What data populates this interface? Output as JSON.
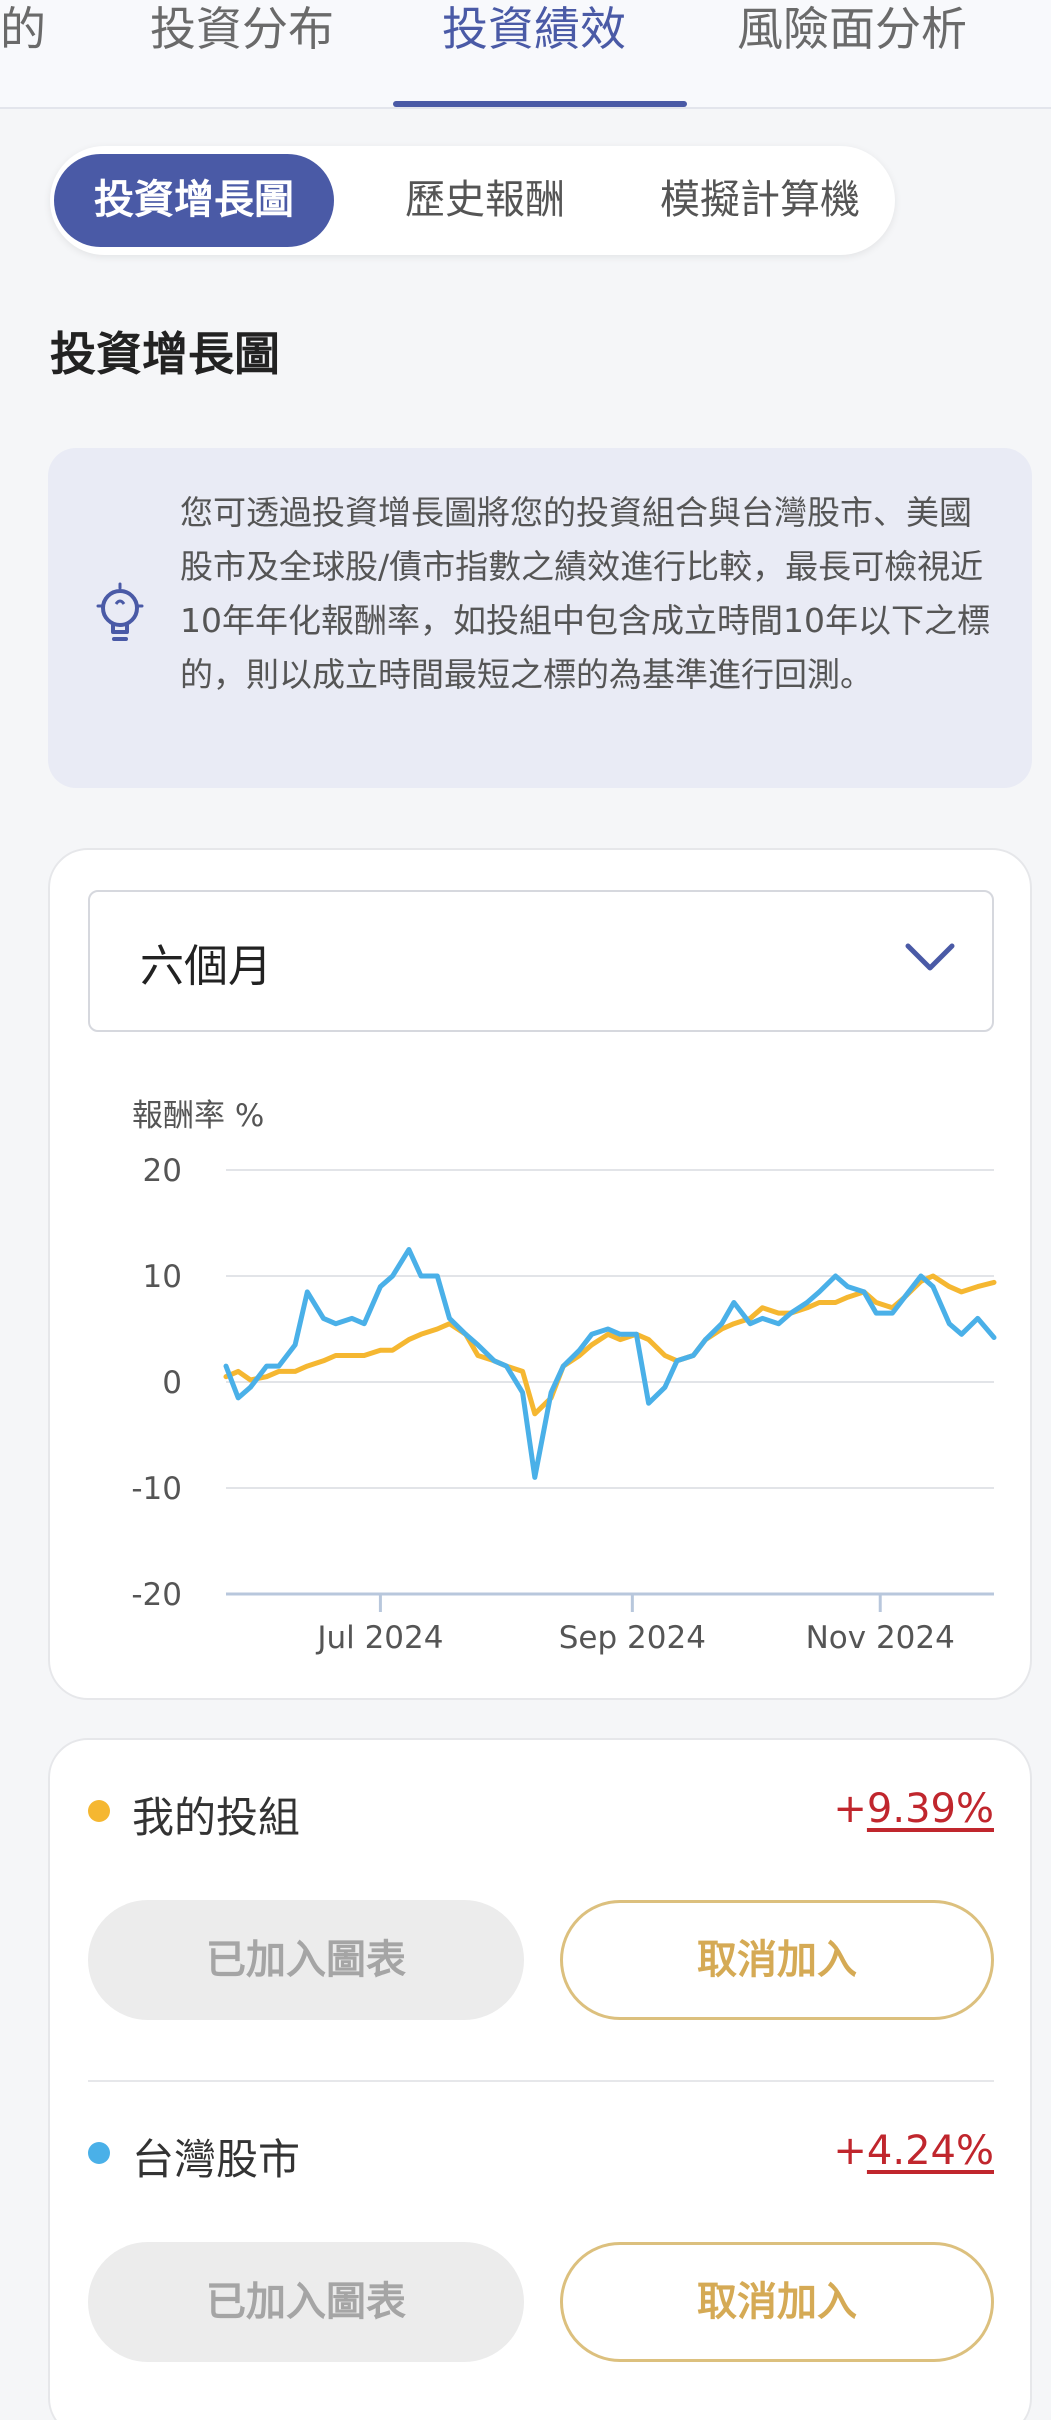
{
  "nav": {
    "tabs": [
      {
        "label": "的",
        "active": false
      },
      {
        "label": "投資分布",
        "active": false
      },
      {
        "label": "投資績效",
        "active": true
      },
      {
        "label": "風險面分析",
        "active": false
      }
    ]
  },
  "segments": [
    {
      "label": "投資增長圖",
      "active": true
    },
    {
      "label": "歷史報酬",
      "active": false
    },
    {
      "label": "模擬計算機",
      "active": false
    }
  ],
  "section_title": "投資增長圖",
  "info": {
    "icon": "lightbulb-icon",
    "text": "您可透過投資增長圖將您的投資組合與台灣股市、美國股市及全球股/債市指數之績效進行比較，最長可檢視近10年年化報酬率，如投組中包含成立時間10年以下之標的，則以成立時間最短之標的為基準進行回測。"
  },
  "period_select": {
    "value": "六個月"
  },
  "chart_data": {
    "type": "line",
    "ylabel": "報酬率 %",
    "ylim": [
      -20,
      20
    ],
    "yticks": [
      "20",
      "10",
      "0",
      "-10",
      "-20"
    ],
    "xlim": [
      "2024-05-24",
      "2024-11-29"
    ],
    "xticks": [
      {
        "label": "Jul 2024",
        "date": "2024-07-01"
      },
      {
        "label": "Sep 2024",
        "date": "2024-09-01"
      },
      {
        "label": "Nov 2024",
        "date": "2024-11-01"
      }
    ],
    "grid": true,
    "series": [
      {
        "name": "我的投組",
        "color": "#f5b731",
        "values": [
          [
            "2024-05-24",
            0.5
          ],
          [
            "2024-05-27",
            1.0
          ],
          [
            "2024-05-30",
            0.2
          ],
          [
            "2024-06-03",
            0.5
          ],
          [
            "2024-06-06",
            1.0
          ],
          [
            "2024-06-10",
            1.0
          ],
          [
            "2024-06-13",
            1.5
          ],
          [
            "2024-06-17",
            2.0
          ],
          [
            "2024-06-20",
            2.5
          ],
          [
            "2024-06-24",
            2.5
          ],
          [
            "2024-06-27",
            2.5
          ],
          [
            "2024-07-01",
            3.0
          ],
          [
            "2024-07-04",
            3.0
          ],
          [
            "2024-07-08",
            4.0
          ],
          [
            "2024-07-11",
            4.5
          ],
          [
            "2024-07-15",
            5.0
          ],
          [
            "2024-07-18",
            5.5
          ],
          [
            "2024-07-22",
            4.5
          ],
          [
            "2024-07-25",
            2.5
          ],
          [
            "2024-07-29",
            2.0
          ],
          [
            "2024-08-01",
            1.5
          ],
          [
            "2024-08-05",
            1.0
          ],
          [
            "2024-08-08",
            -3.0
          ],
          [
            "2024-08-12",
            -1.5
          ],
          [
            "2024-08-15",
            1.5
          ],
          [
            "2024-08-19",
            2.5
          ],
          [
            "2024-08-22",
            3.5
          ],
          [
            "2024-08-26",
            4.5
          ],
          [
            "2024-08-29",
            4.0
          ],
          [
            "2024-09-02",
            4.5
          ],
          [
            "2024-09-05",
            4.0
          ],
          [
            "2024-09-09",
            2.5
          ],
          [
            "2024-09-12",
            2.0
          ],
          [
            "2024-09-16",
            2.5
          ],
          [
            "2024-09-19",
            4.0
          ],
          [
            "2024-09-23",
            5.0
          ],
          [
            "2024-09-26",
            5.5
          ],
          [
            "2024-09-30",
            6.0
          ],
          [
            "2024-10-03",
            7.0
          ],
          [
            "2024-10-07",
            6.5
          ],
          [
            "2024-10-10",
            6.5
          ],
          [
            "2024-10-14",
            7.0
          ],
          [
            "2024-10-17",
            7.5
          ],
          [
            "2024-10-21",
            7.5
          ],
          [
            "2024-10-24",
            8.0
          ],
          [
            "2024-10-28",
            8.5
          ],
          [
            "2024-10-31",
            7.5
          ],
          [
            "2024-11-04",
            7.0
          ],
          [
            "2024-11-07",
            8.0
          ],
          [
            "2024-11-11",
            9.5
          ],
          [
            "2024-11-14",
            10.0
          ],
          [
            "2024-11-18",
            9.0
          ],
          [
            "2024-11-21",
            8.5
          ],
          [
            "2024-11-25",
            9.0
          ],
          [
            "2024-11-29",
            9.4
          ]
        ]
      },
      {
        "name": "台灣股市",
        "color": "#4ab0e8",
        "values": [
          [
            "2024-05-24",
            1.5
          ],
          [
            "2024-05-27",
            -1.5
          ],
          [
            "2024-05-30",
            -0.5
          ],
          [
            "2024-06-03",
            1.5
          ],
          [
            "2024-06-06",
            1.5
          ],
          [
            "2024-06-10",
            3.5
          ],
          [
            "2024-06-13",
            8.5
          ],
          [
            "2024-06-17",
            6.0
          ],
          [
            "2024-06-20",
            5.5
          ],
          [
            "2024-06-24",
            6.0
          ],
          [
            "2024-06-27",
            5.5
          ],
          [
            "2024-07-01",
            9.0
          ],
          [
            "2024-07-04",
            10.0
          ],
          [
            "2024-07-08",
            12.5
          ],
          [
            "2024-07-11",
            10.0
          ],
          [
            "2024-07-15",
            10.0
          ],
          [
            "2024-07-18",
            6.0
          ],
          [
            "2024-07-22",
            4.5
          ],
          [
            "2024-07-25",
            3.5
          ],
          [
            "2024-07-29",
            2.0
          ],
          [
            "2024-08-01",
            1.5
          ],
          [
            "2024-08-05",
            -1.0
          ],
          [
            "2024-08-08",
            -9.0
          ],
          [
            "2024-08-12",
            -1.0
          ],
          [
            "2024-08-15",
            1.5
          ],
          [
            "2024-08-19",
            3.0
          ],
          [
            "2024-08-22",
            4.5
          ],
          [
            "2024-08-26",
            5.0
          ],
          [
            "2024-08-29",
            4.5
          ],
          [
            "2024-09-02",
            4.5
          ],
          [
            "2024-09-05",
            -2.0
          ],
          [
            "2024-09-09",
            -0.5
          ],
          [
            "2024-09-12",
            2.0
          ],
          [
            "2024-09-16",
            2.5
          ],
          [
            "2024-09-19",
            4.0
          ],
          [
            "2024-09-23",
            5.5
          ],
          [
            "2024-09-26",
            7.5
          ],
          [
            "2024-09-30",
            5.5
          ],
          [
            "2024-10-03",
            6.0
          ],
          [
            "2024-10-07",
            5.5
          ],
          [
            "2024-10-10",
            6.5
          ],
          [
            "2024-10-14",
            7.5
          ],
          [
            "2024-10-17",
            8.5
          ],
          [
            "2024-10-21",
            10.0
          ],
          [
            "2024-10-24",
            9.0
          ],
          [
            "2024-10-28",
            8.5
          ],
          [
            "2024-10-31",
            6.5
          ],
          [
            "2024-11-04",
            6.5
          ],
          [
            "2024-11-07",
            8.0
          ],
          [
            "2024-11-11",
            10.0
          ],
          [
            "2024-11-14",
            9.0
          ],
          [
            "2024-11-18",
            5.5
          ],
          [
            "2024-11-21",
            4.5
          ],
          [
            "2024-11-25",
            6.0
          ],
          [
            "2024-11-29",
            4.2
          ]
        ]
      }
    ]
  },
  "comparisons": [
    {
      "name": "我的投組",
      "dot_color": "#f5b731",
      "sign": "+",
      "return": "9.39%",
      "added_label": "已加入圖表",
      "cancel_label": "取消加入"
    },
    {
      "name": "台灣股市",
      "dot_color": "#4ab0e8",
      "sign": "+",
      "return": "4.24%",
      "added_label": "已加入圖表",
      "cancel_label": "取消加入"
    }
  ]
}
